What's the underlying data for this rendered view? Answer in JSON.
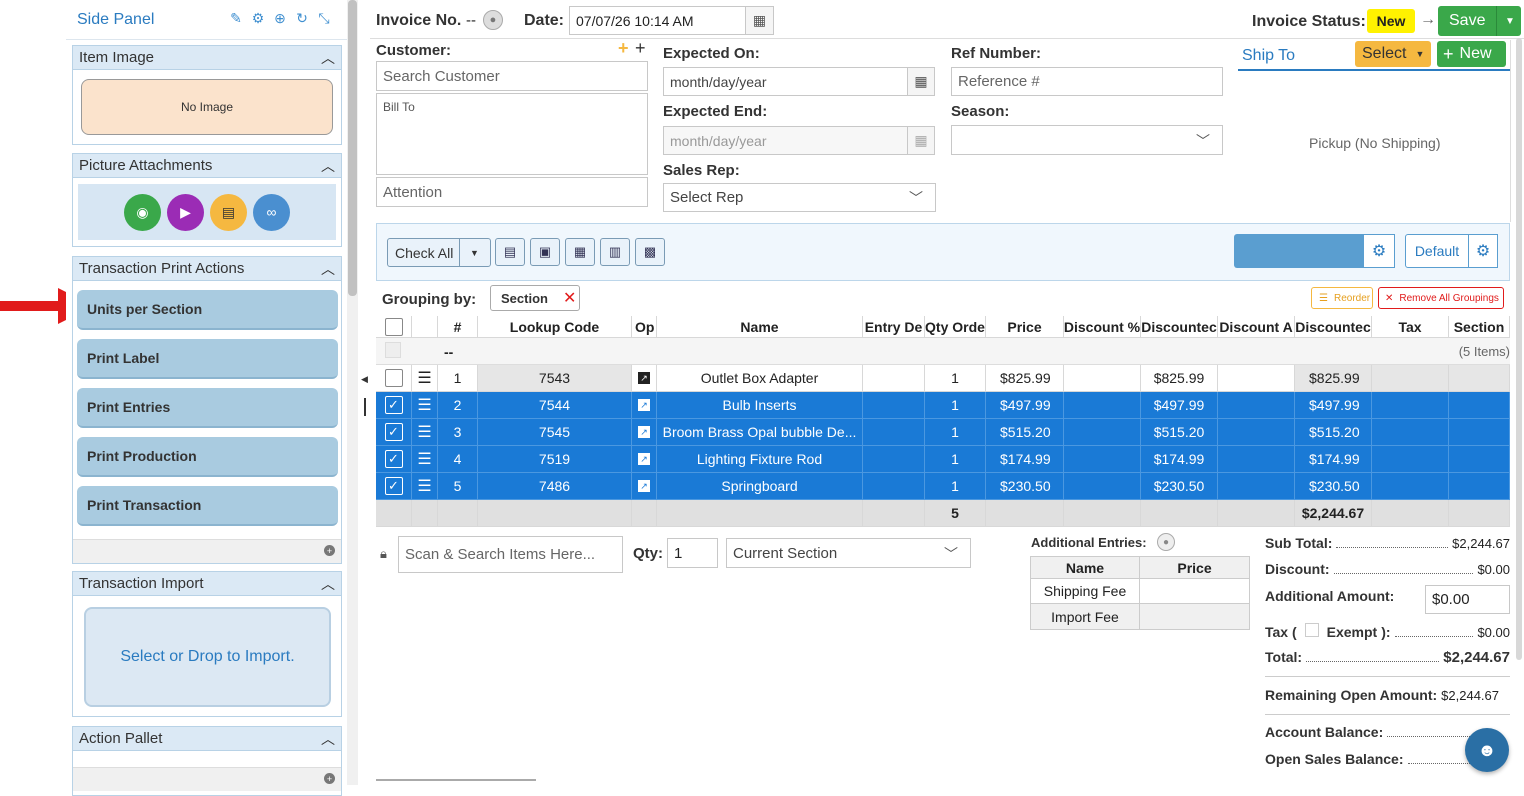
{
  "side_panel": {
    "title": "Side Panel",
    "item_image": {
      "header": "Item Image",
      "placeholder": "No Image"
    },
    "picture_attachments": {
      "header": "Picture Attachments"
    },
    "print_actions": {
      "header": "Transaction Print Actions",
      "buttons": [
        "Units per Section",
        "Print Label",
        "Print Entries",
        "Print Production",
        "Print Transaction"
      ]
    },
    "import": {
      "header": "Transaction Import",
      "drop_text": "Select or Drop to Import."
    },
    "action_pallet": {
      "header": "Action Pallet"
    }
  },
  "header": {
    "invoice_no_label": "Invoice No.",
    "invoice_no_value": "--",
    "date_label": "Date:",
    "date_value": "07/07/26 10:14 AM",
    "status_label": "Invoice Status:",
    "status_value": "New",
    "save_label": "Save"
  },
  "customer": {
    "label": "Customer:",
    "search_placeholder": "Search Customer",
    "bill_to_placeholder": "Bill To",
    "attention_placeholder": "Attention"
  },
  "dates": {
    "expected_on_label": "Expected On:",
    "expected_on_placeholder": "month/day/year",
    "expected_end_label": "Expected End:",
    "expected_end_placeholder": "month/day/year",
    "sales_rep_label": "Sales Rep:",
    "sales_rep_value": "Select Rep"
  },
  "ref": {
    "ref_label": "Ref Number:",
    "ref_placeholder": "Reference #",
    "season_label": "Season:"
  },
  "ship_to": {
    "title": "Ship To",
    "select_label": "Select",
    "new_label": "New",
    "pickup_text": "Pickup (No Shipping)"
  },
  "toolbar": {
    "check_all_label": "Check All",
    "default_label": "Default"
  },
  "grouping": {
    "label": "Grouping by:",
    "chip": "Section",
    "reorder_label": "Reorder",
    "remove_all_label": "Remove All Groupings"
  },
  "table": {
    "columns": [
      "#",
      "Lookup Code",
      "Op",
      "Name",
      "Entry De",
      "Qty Orde",
      "Price",
      "Discount %",
      "Discountec",
      "Discount A",
      "Discountec",
      "Tax",
      "Section"
    ],
    "group_row": {
      "label": "--",
      "count": "(5 Items)"
    },
    "rows": [
      {
        "num": "1",
        "code": "7543",
        "name": "Outlet Box Adapter",
        "qty": "1",
        "price": "$825.99",
        "disc_price": "$825.99",
        "disc_total": "$825.99",
        "selected": false
      },
      {
        "num": "2",
        "code": "7544",
        "name": "Bulb Inserts",
        "qty": "1",
        "price": "$497.99",
        "disc_price": "$497.99",
        "disc_total": "$497.99",
        "selected": true
      },
      {
        "num": "3",
        "code": "7545",
        "name": "Broom Brass Opal bubble De...",
        "qty": "1",
        "price": "$515.20",
        "disc_price": "$515.20",
        "disc_total": "$515.20",
        "selected": true
      },
      {
        "num": "4",
        "code": "7519",
        "name": "Lighting Fixture Rod",
        "qty": "1",
        "price": "$174.99",
        "disc_price": "$174.99",
        "disc_total": "$174.99",
        "selected": true
      },
      {
        "num": "5",
        "code": "7486",
        "name": "Springboard",
        "qty": "1",
        "price": "$230.50",
        "disc_price": "$230.50",
        "disc_total": "$230.50",
        "selected": true
      }
    ],
    "footer": {
      "qty_total": "5",
      "amount_total": "$2,244.67"
    }
  },
  "scan": {
    "placeholder": "Scan & Search Items Here...",
    "qty_label": "Qty:",
    "qty_value": "1",
    "section_value": "Current Section"
  },
  "additional_entries": {
    "title": "Additional Entries:",
    "headers": [
      "Name",
      "Price"
    ],
    "rows": [
      "Shipping Fee",
      "Import Fee"
    ]
  },
  "summary": {
    "sub_total_label": "Sub Total:",
    "sub_total_value": "$2,244.67",
    "discount_label": "Discount:",
    "discount_value": "$0.00",
    "additional_label": "Additional Amount:",
    "additional_value": "$0.00",
    "tax_label_a": "Tax (",
    "tax_label_b": "Exempt",
    "tax_label_c": "):",
    "tax_value": "$0.00",
    "total_label": "Total:",
    "total_value": "$2,244.67",
    "remaining_label": "Remaining Open Amount:",
    "remaining_value": "$2,244.67",
    "account_balance_label": "Account Balance:",
    "open_sales_label": "Open Sales Balance:"
  },
  "colors": {
    "accent_blue": "#1a7ad6",
    "save_green": "#3aa84a",
    "status_yellow": "#fff200",
    "select_orange": "#f5b840",
    "arrow_red": "#e11b1b"
  }
}
